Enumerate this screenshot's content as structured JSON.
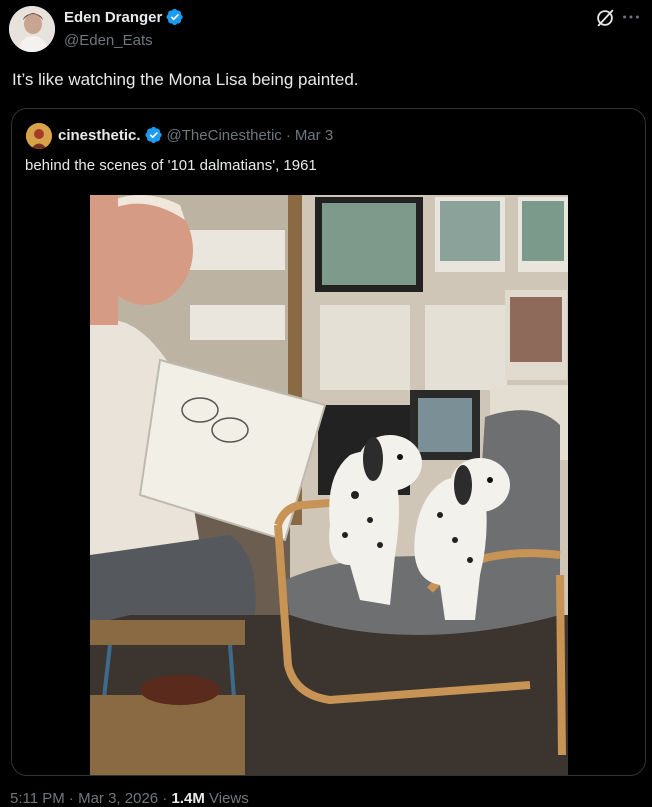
{
  "author": {
    "name": "Eden Dranger",
    "handle": "@Eden_Eats",
    "avatar_icon": "profile-photo"
  },
  "tweet": {
    "text": "It’s like watching the Mona Lisa being painted."
  },
  "quote": {
    "name": "cinesthetic.",
    "handle": "@TheCinesthetic",
    "separator": "·",
    "date": "Mar 3",
    "text": "behind the scenes of '101 dalmatians', 1961"
  },
  "footer": {
    "time": "5:11 PM",
    "separator1": "·",
    "date": "Mar 3, 2026",
    "separator2": "·",
    "views_count": "1.4M",
    "views_label": "Views"
  },
  "colors": {
    "background": "#000000",
    "text_primary": "#e7e9ea",
    "text_secondary": "#71767b",
    "border": "#2f3336",
    "verified": "#1d9bf0"
  },
  "icons": [
    "verified-badge-icon",
    "grok-icon",
    "more-icon"
  ]
}
